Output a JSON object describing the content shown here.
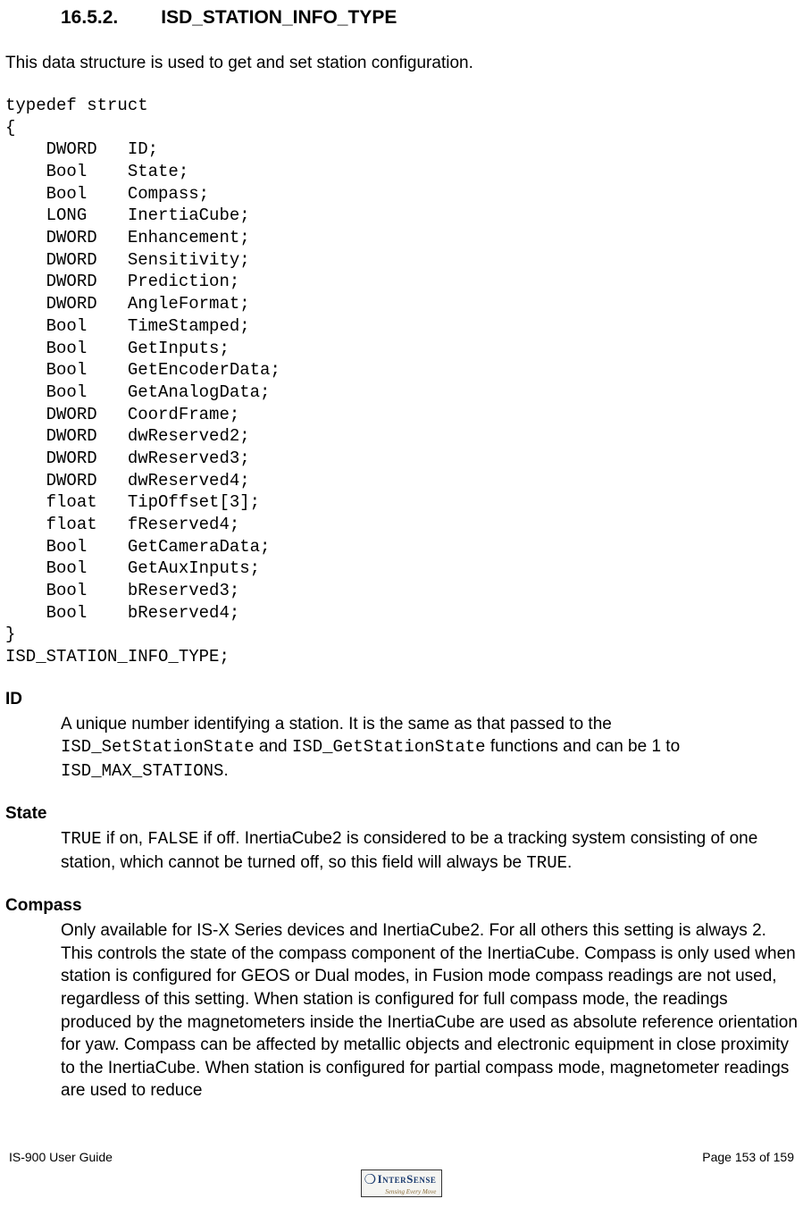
{
  "heading": {
    "number": "16.5.2.",
    "title": "ISD_STATION_INFO_TYPE"
  },
  "intro": "This data structure is used to get and set station configuration.",
  "code": "typedef struct\n{\n    DWORD   ID;\n    Bool    State;\n    Bool    Compass;\n    LONG    InertiaCube;\n    DWORD   Enhancement;\n    DWORD   Sensitivity;\n    DWORD   Prediction;\n    DWORD   AngleFormat;\n    Bool    TimeStamped;\n    Bool    GetInputs;\n    Bool    GetEncoderData;\n    Bool    GetAnalogData;\n    DWORD   CoordFrame;\n    DWORD   dwReserved2;\n    DWORD   dwReserved3;\n    DWORD   dwReserved4;\n    float   TipOffset[3];\n    float   fReserved4;\n    Bool    GetCameraData;\n    Bool    GetAuxInputs;\n    Bool    bReserved3;\n    Bool    bReserved4;\n}\nISD_STATION_INFO_TYPE;",
  "terms": {
    "id": {
      "label": "ID",
      "p1": "A unique number identifying a station. It is the same as that passed to the ",
      "c1": "ISD_SetStationState",
      "p2": " and ",
      "c2": "ISD_GetStationState",
      "p3": " functions and can be 1 to ",
      "c3": "ISD_MAX_STATIONS",
      "p4": "."
    },
    "state": {
      "label": "State",
      "c1": "TRUE",
      "p1": " if on, ",
      "c2": "FALSE",
      "p2": " if off.  InertiaCube2 is considered to be a tracking system consisting of one station, which cannot be turned off, so this field will always be ",
      "c3": "TRUE",
      "p3": "."
    },
    "compass": {
      "label": "Compass",
      "p1": "Only available for IS-X Series devices and InertiaCube2.  For all others this setting is always 2.  This controls the state of the compass component of the InertiaCube. Compass is only used when station is configured for GEOS or Dual modes, in Fusion mode compass readings are not used, regardless of this setting.  When station is configured for full compass mode, the readings produced by the magnetometers inside the InertiaCube are used as absolute reference orientation for yaw.  Compass can be affected by metallic objects and electronic equipment in close proximity to the InertiaCube. When station is configured for partial compass mode, magnetometer readings are used to reduce"
    }
  },
  "footer": {
    "left": "IS-900 User Guide",
    "right": "Page 153 of 159",
    "logo_main": "InterSense",
    "logo_sub": "Sensing Every Move"
  }
}
